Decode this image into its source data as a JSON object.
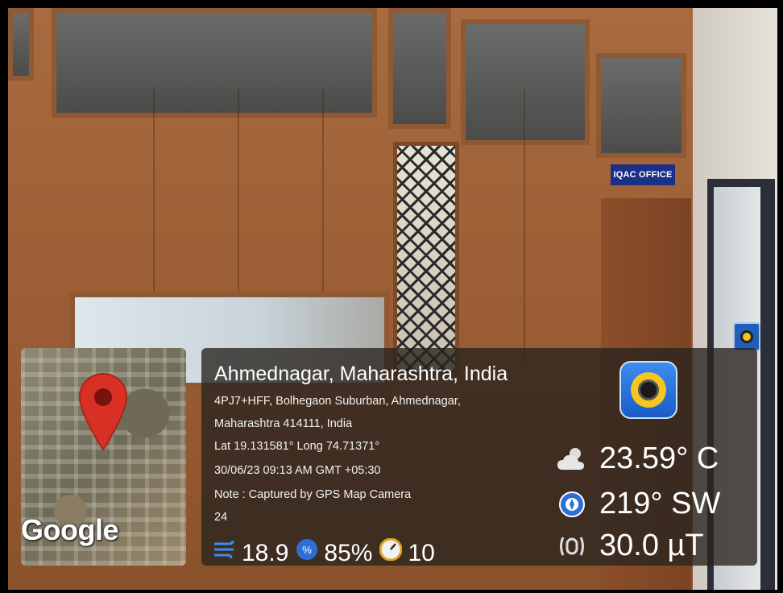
{
  "sign": {
    "text": "IQAC OFFICE"
  },
  "map": {
    "logo": "Google"
  },
  "location": {
    "title": "Ahmednagar, Maharashtra, India",
    "address_line1": "4PJ7+HFF, Bolhegaon Suburban, Ahmednagar,",
    "address_line2": "Maharashtra 414111, India",
    "coords": "Lat 19.131581° Long 74.71371°",
    "datetime": "30/06/23 09:13 AM GMT +05:30",
    "note": "Note : Captured by GPS Map Camera",
    "extra": "24"
  },
  "stats": {
    "temperature": "23.59° C",
    "wind_direction": "219° SW",
    "magnetic": "30.0 µT"
  },
  "bottom_stats": {
    "wind": "18.9",
    "humidity": "85%",
    "pressure": "10"
  },
  "icons": {
    "map_pin": "map-pin-icon",
    "weather": "cloud-sun-icon",
    "compass": "compass-icon",
    "magnet": "magnet-icon",
    "wind": "wind-icon",
    "humidity": "humidity-icon",
    "pressure": "pressure-gauge-icon",
    "app": "gps-camera-app-icon"
  },
  "colors": {
    "pin": "#d93025",
    "sign_bg": "#1b2e88",
    "app_blue": "#1a5cc7",
    "lens_yellow": "#f7c51d"
  }
}
